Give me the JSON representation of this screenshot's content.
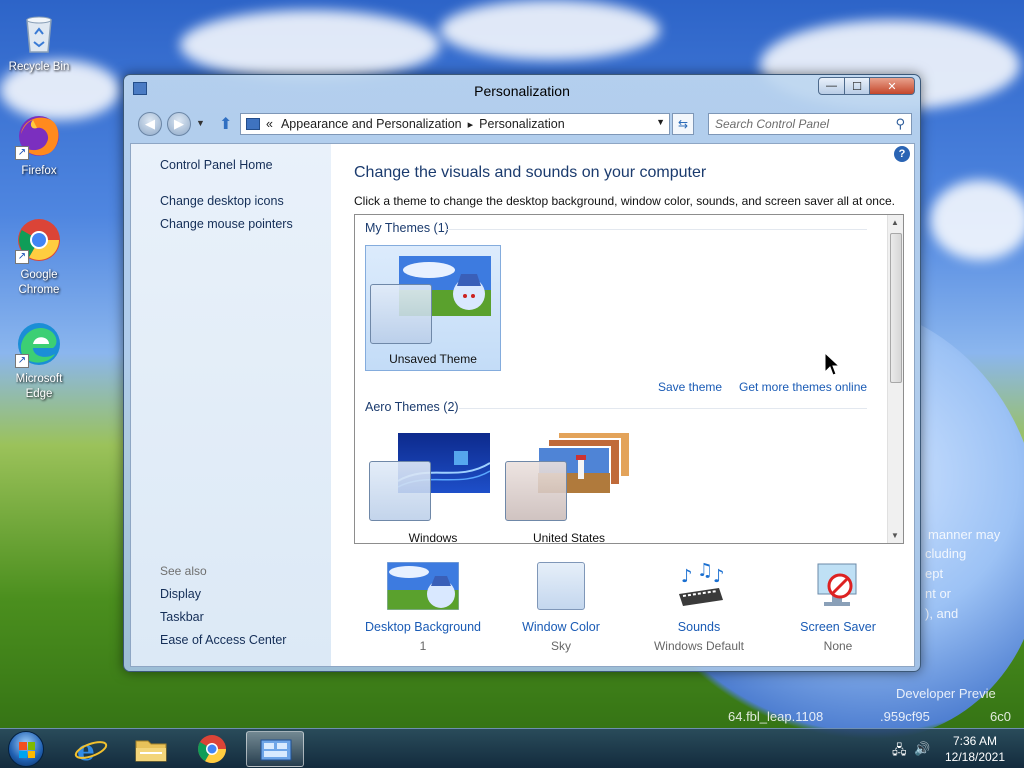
{
  "desktop": {
    "icons": [
      {
        "label": "Recycle Bin",
        "icon": "recycle-bin-icon"
      },
      {
        "label": "Firefox",
        "icon": "firefox-icon"
      },
      {
        "label": "Google Chrome",
        "icon": "chrome-icon"
      },
      {
        "label": "Microsoft Edge",
        "icon": "edge-icon"
      }
    ],
    "watermark": {
      "line1": "manner may",
      "line2": "cluding",
      "line3": "ept",
      "line4": "nt or",
      "line5": "), and",
      "line6": "Developer Previe",
      "line7": "64.fbl_leap.1108",
      "line8": ".959cf95",
      "line9": "6c0"
    }
  },
  "window": {
    "title": "Personalization",
    "caption": {
      "minimize": "—",
      "maximize": "☐",
      "close": "✕"
    },
    "address": {
      "chevron": "«",
      "crumbs": [
        "Appearance and Personalization",
        "Personalization"
      ],
      "separator": "▸"
    },
    "search": {
      "placeholder": "Search Control Panel"
    },
    "left_pane": {
      "home": "Control Panel Home",
      "links": [
        "Change desktop icons",
        "Change mouse pointers"
      ],
      "see_also_label": "See also",
      "see_also": [
        "Display",
        "Taskbar",
        "Ease of Access Center"
      ]
    },
    "main": {
      "heading": "Change the visuals and sounds on your computer",
      "subtitle": "Click a theme to change the desktop background, window color, sounds, and screen saver all at once.",
      "groups": {
        "my_themes": "My Themes (1)",
        "aero_themes": "Aero Themes (2)"
      },
      "themes": {
        "unsaved": "Unsaved Theme",
        "windows": "Windows",
        "united_states": "United States"
      },
      "links": {
        "save_theme": "Save theme",
        "get_more": "Get more themes online"
      },
      "bottom": [
        {
          "label": "Desktop Background",
          "value": "1"
        },
        {
          "label": "Window Color",
          "value": "Sky"
        },
        {
          "label": "Sounds",
          "value": "Windows Default"
        },
        {
          "label": "Screen Saver",
          "value": "None"
        }
      ]
    }
  },
  "taskbar": {
    "clock": {
      "time": "7:36 AM",
      "date": "12/18/2021"
    },
    "items": [
      "internet-explorer-icon",
      "file-explorer-icon",
      "chrome-icon",
      "control-panel-icon"
    ]
  },
  "colors": {
    "link": "#1a5bb5",
    "heading": "#1b3b6e",
    "selection": "#c3dcf7"
  }
}
